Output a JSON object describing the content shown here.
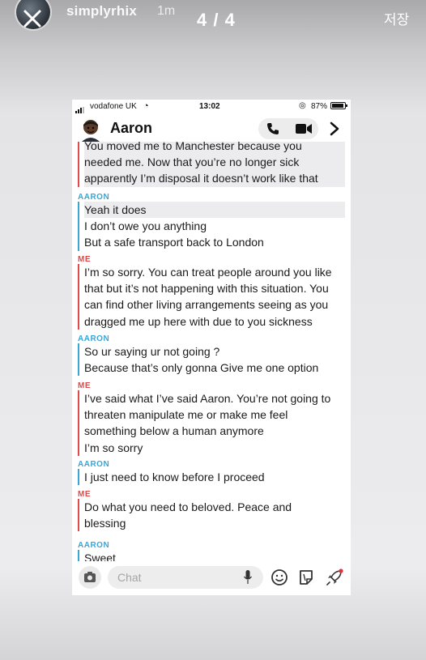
{
  "story": {
    "username": "simplyrhix",
    "time_ago": "1m",
    "page_counter": "4 / 4",
    "save_label": "저장"
  },
  "status_bar": {
    "carrier": "vodafone UK",
    "time": "13:02",
    "battery": "87%"
  },
  "chat": {
    "contact_name": "Aaron",
    "input_placeholder": "Chat",
    "blocks": [
      {
        "sender": "",
        "lines": [
          "You moved me to Manchester because you",
          "needed me. Now that you’re no longer sick",
          "apparently I’m disposal it doesn’t work like that"
        ]
      },
      {
        "sender": "AARON",
        "lines": [
          "Yeah it does",
          "I don’t owe you anything",
          "But a safe transport back to London"
        ]
      },
      {
        "sender": "ME",
        "lines": [
          "I’m so sorry. You can treat people around you like",
          "that but it’s not happening with this situation. You",
          "can find other living arrangements seeing as you",
          "dragged me up here with due to you sickness"
        ]
      },
      {
        "sender": "AARON",
        "lines": [
          "So ur saying ur not going ?",
          "Because that’s only gonna Give me one option"
        ]
      },
      {
        "sender": "ME",
        "lines": [
          "I’ve said what I’ve said Aaron. You’re not going to",
          "threaten manipulate me or make me feel",
          "something below a human anymore",
          "I’m so sorry"
        ]
      },
      {
        "sender": "AARON",
        "lines": [
          "I just need to know before I proceed"
        ]
      },
      {
        "sender": "ME",
        "lines": [
          "Do what you need to beloved. Peace and",
          "blessing"
        ]
      },
      {
        "sender": "AARON",
        "lines": [
          "Sweet"
        ]
      }
    ]
  },
  "colors": {
    "aaron_accent": "#3aa6d6",
    "me_accent": "#e04a4a"
  },
  "icons": [
    "close-icon",
    "signal-icon",
    "wifi-icon",
    "alarm-icon",
    "battery-icon",
    "bitmoji-avatar",
    "phone-icon",
    "video-icon",
    "chevron-right-icon",
    "camera-icon",
    "mic-icon",
    "smiley-icon",
    "sticker-icon",
    "rocket-icon"
  ]
}
